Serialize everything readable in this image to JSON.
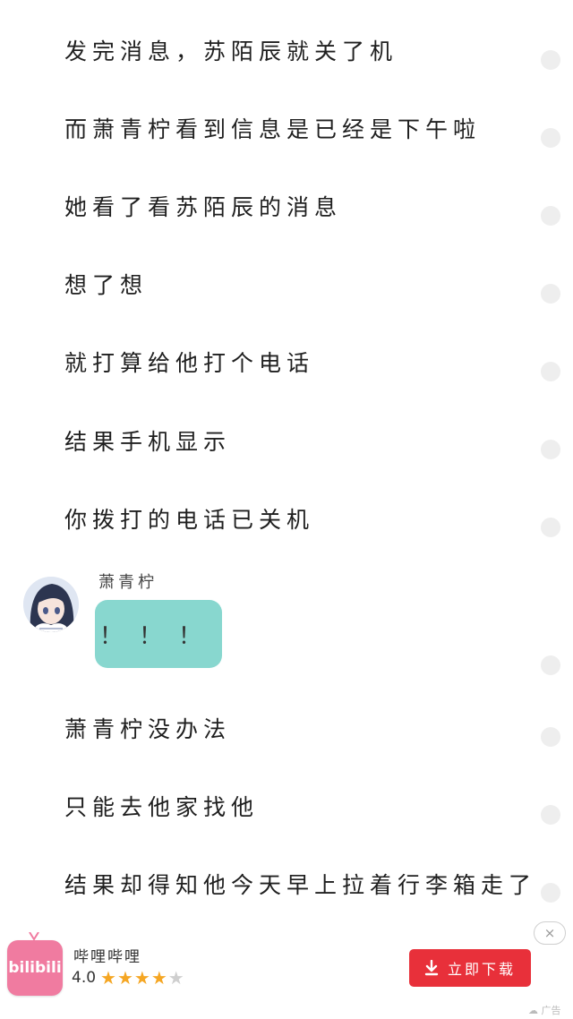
{
  "story_lines_top": [
    "发完消息，苏陌辰就关了机",
    "而萧青柠看到信息是已经是下午啦",
    "她看了看苏陌辰的消息",
    "想了想",
    "就打算给他打个电话",
    "结果手机显示",
    "你拨打的电话已关机"
  ],
  "chat": {
    "speaker_name": "萧青柠",
    "bubble_text": "！！！"
  },
  "story_lines_bottom": [
    "萧青柠没办法",
    "只能去他家找他",
    "结果却得知他今天早上拉着行李箱走了"
  ],
  "ad": {
    "logo_text": "bilibili",
    "app_name": "哔哩哔哩",
    "rating": "4.0",
    "stars_filled": 4,
    "stars_total": 5,
    "download_label": "立即下载",
    "close_symbol": "×",
    "ad_label": "广告",
    "colors": {
      "button": "#e8303a",
      "logo": "#f07ba0",
      "star": "#f5a623"
    }
  },
  "colors": {
    "bubble": "#88d7cf",
    "dot": "#eeeeee"
  }
}
